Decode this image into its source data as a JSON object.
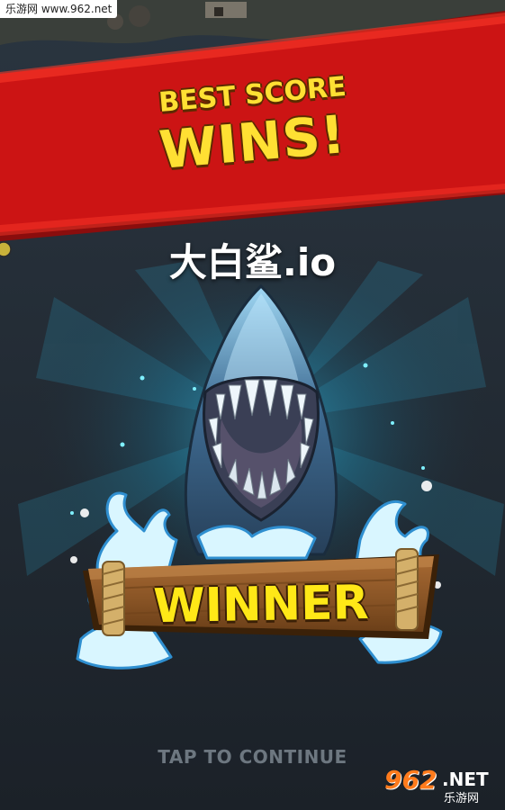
{
  "watermark_top": {
    "text": "乐游网 www.962.net"
  },
  "banner": {
    "line1": "BEST SCORE",
    "line2": "WINS!",
    "color": "#cc1414",
    "text_color": "#ffe033"
  },
  "game_title": "大白鲨.io",
  "winner_sign": {
    "label": "WINNER",
    "wood_color": "#8a5526"
  },
  "tap_prompt": "TAP TO CONTINUE",
  "watermark_br": {
    "logo": "962",
    "net": ".NET",
    "cn": "乐游网"
  },
  "icons": {
    "shark": "shark-icon",
    "splash": "water-splash-icon",
    "rope": "rope-icon",
    "sparkle": "sparkle-icon"
  }
}
